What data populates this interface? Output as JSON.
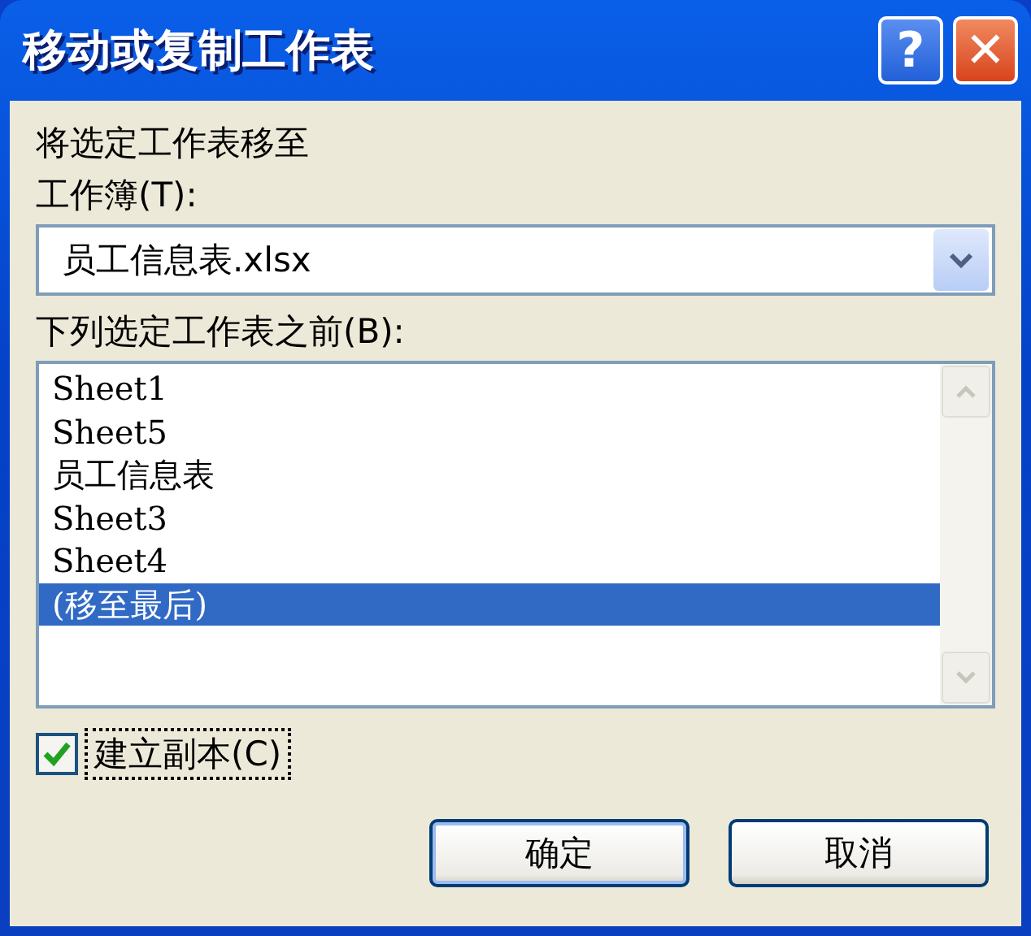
{
  "window": {
    "title": "移动或复制工作表"
  },
  "title_buttons": [
    {
      "kind": "help",
      "label": "?"
    },
    {
      "kind": "close",
      "label": "✕"
    }
  ],
  "move_to_label": "将选定工作表移至",
  "workbook": {
    "label": "工作簿(T):",
    "value": "员工信息表.xlsx"
  },
  "before_label": "下列选定工作表之前(B):",
  "sheets": [
    {
      "label": "Sheet1",
      "selected": false
    },
    {
      "label": "Sheet5",
      "selected": false
    },
    {
      "label": "员工信息表",
      "selected": false
    },
    {
      "label": "Sheet3",
      "selected": false
    },
    {
      "label": "Sheet4",
      "selected": false
    },
    {
      "label": "(移至最后)",
      "selected": true
    }
  ],
  "create_copy": {
    "label": "建立副本(C)",
    "checked": true
  },
  "buttons": [
    "确定",
    "取消"
  ]
}
